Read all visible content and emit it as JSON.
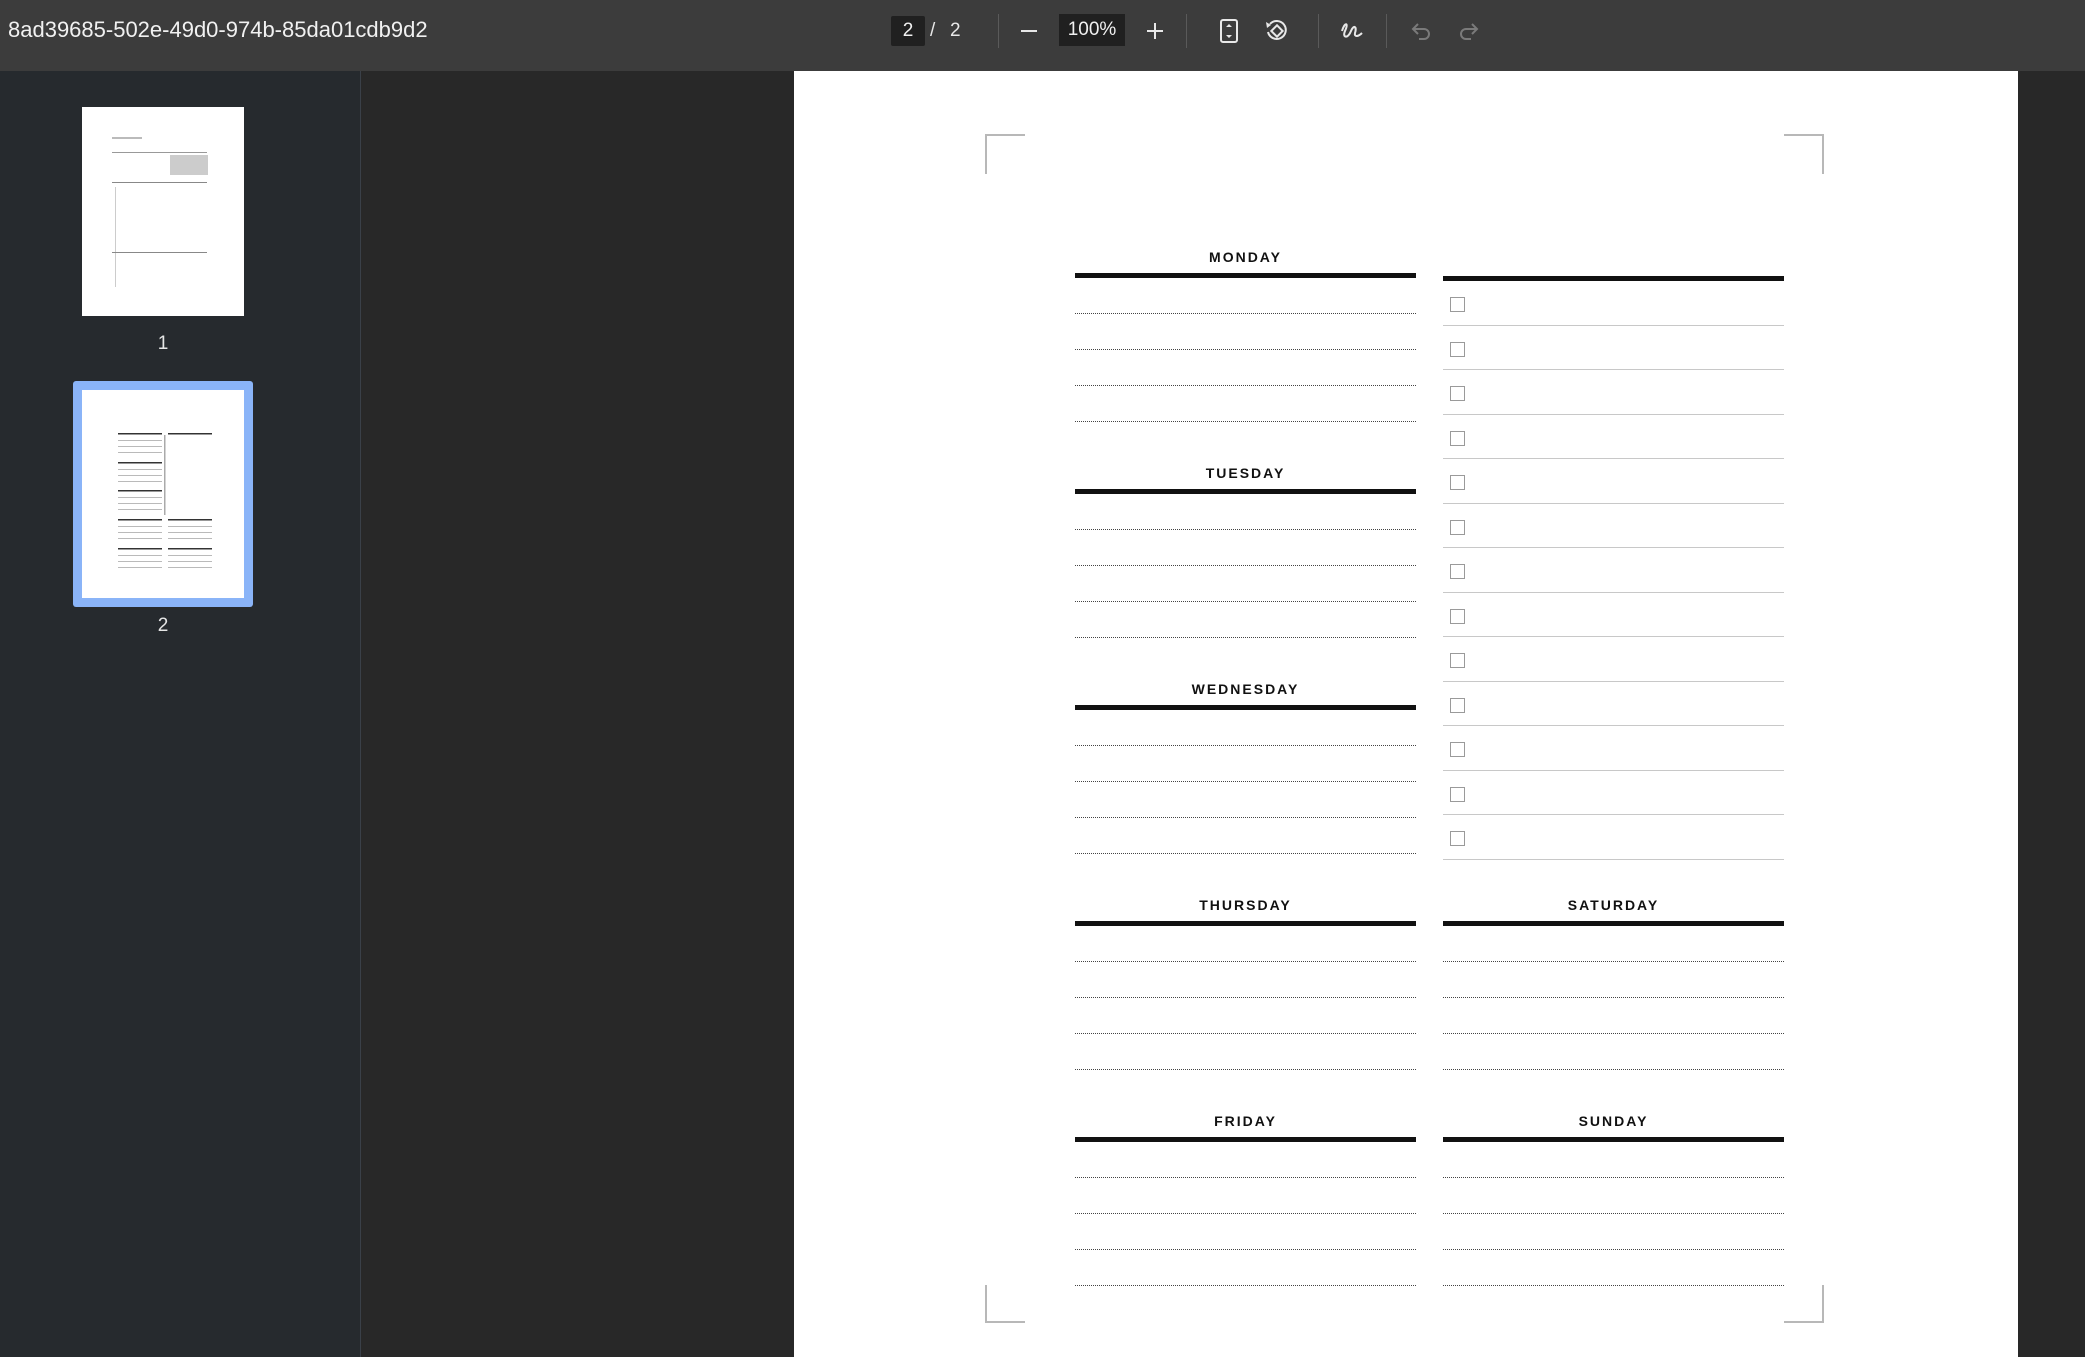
{
  "toolbar": {
    "title": "8ad39685-502e-49d0-974b-85da01cdb9d2",
    "current_page": "2",
    "page_separator": "/",
    "total_pages": "2",
    "zoom": "100%",
    "icons": [
      "zoom-out-icon",
      "zoom-in-icon",
      "fit-page-icon",
      "rotate-icon",
      "draw-icon",
      "undo-icon",
      "redo-icon"
    ]
  },
  "sidebar": {
    "thumbnails": [
      {
        "label": "1"
      },
      {
        "label": "2"
      }
    ]
  },
  "planner": {
    "days_left": [
      {
        "name": "MONDAY"
      },
      {
        "name": "TUESDAY"
      },
      {
        "name": "WEDNESDAY"
      },
      {
        "name": "THURSDAY"
      },
      {
        "name": "FRIDAY"
      }
    ],
    "days_right": [
      {
        "name": "SATURDAY"
      },
      {
        "name": "SUNDAY"
      }
    ],
    "todo_count": 13,
    "lines_per_day": 4
  },
  "colors": {
    "accent": "#8ab4f8",
    "toolbar_bg": "#3c3c3c",
    "viewer_bg": "#282828"
  }
}
